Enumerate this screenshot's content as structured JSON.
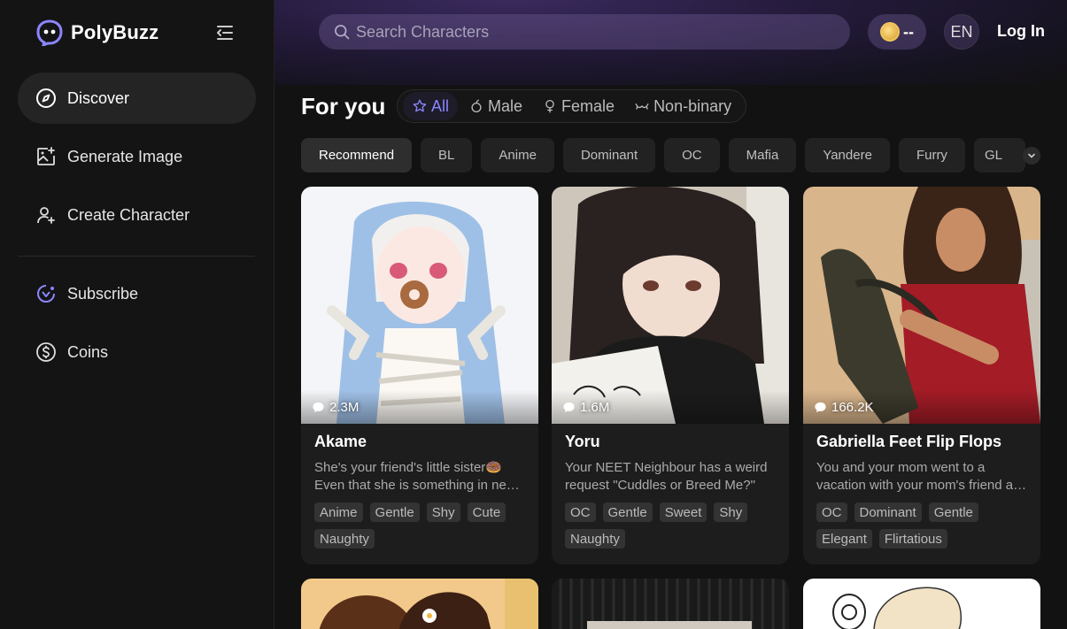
{
  "brand": {
    "name": "PolyBuzz"
  },
  "sidebar": {
    "items": [
      {
        "label": "Discover",
        "icon": "compass-icon"
      },
      {
        "label": "Generate Image",
        "icon": "image-plus-icon"
      },
      {
        "label": "Create Character",
        "icon": "user-plus-icon"
      },
      {
        "label": "Subscribe",
        "icon": "crown-badge-icon"
      },
      {
        "label": "Coins",
        "icon": "dollar-coin-icon"
      }
    ]
  },
  "header": {
    "search_placeholder": "Search Characters",
    "coins": "--",
    "language": "EN",
    "login": "Log In"
  },
  "feed": {
    "title": "For you",
    "gender_tabs": [
      "All",
      "Male",
      "Female",
      "Non-binary"
    ],
    "categories": [
      "Recommend",
      "BL",
      "Anime",
      "Dominant",
      "OC",
      "Mafia",
      "Yandere",
      "Furry",
      "GL"
    ]
  },
  "cards": [
    {
      "name": "Akame",
      "chats": "2.3M",
      "description": "She's your friend's little sister🍩 Even that she is something in need of care...",
      "tags": [
        "Anime",
        "Gentle",
        "Shy",
        "Cute",
        "Naughty"
      ]
    },
    {
      "name": "Yoru",
      "chats": "1.6M",
      "description": "Your NEET Neighbour has a weird request \"Cuddles or Breed Me?\"",
      "tags": [
        "OC",
        "Gentle",
        "Sweet",
        "Shy",
        "Naughty"
      ]
    },
    {
      "name": "Gabriella Feet Flip Flops",
      "chats": "166.2K",
      "description": "You and your mom went to a vacation with your mom's friend and her daughter...",
      "tags": [
        "OC",
        "Dominant",
        "Gentle",
        "Elegant",
        "Flirtatious"
      ]
    }
  ],
  "colors": {
    "accent": "#8b86ff",
    "background": "#121212",
    "card": "#1d1d1d"
  }
}
